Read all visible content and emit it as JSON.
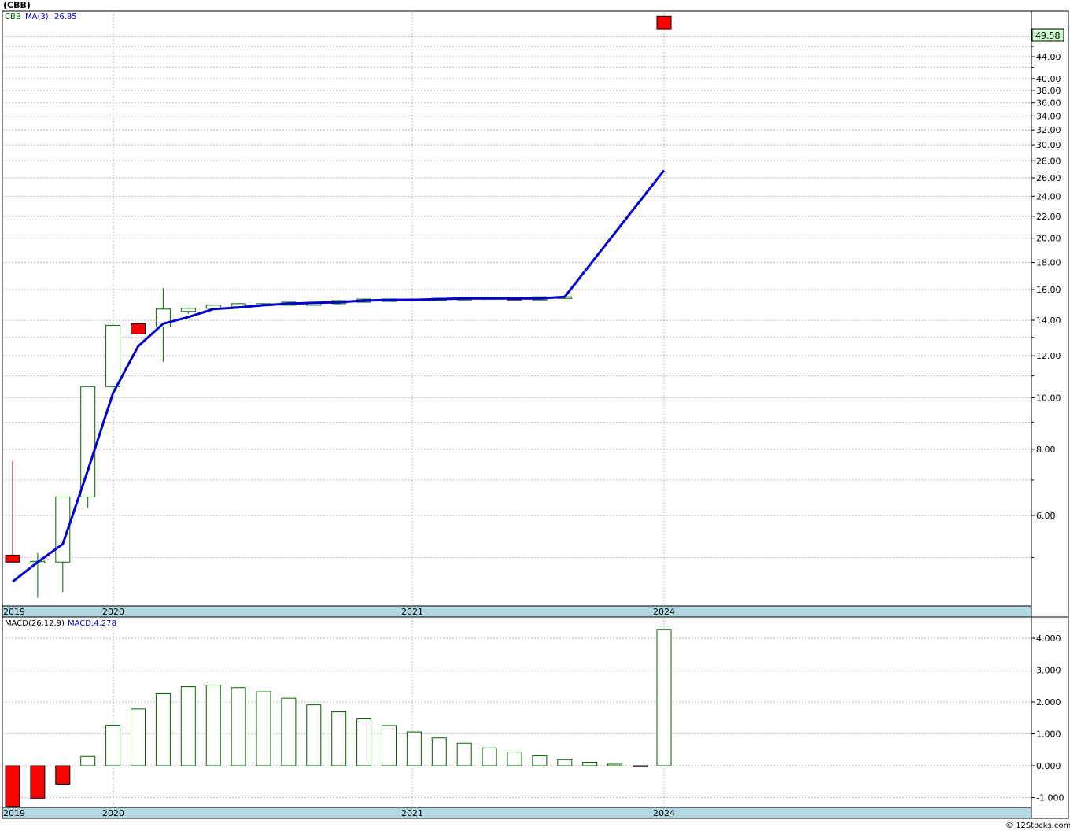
{
  "title": "(CBB)",
  "credit": "© 12Stocks.com",
  "colors": {
    "up_candle_border": "#006400",
    "down_candle_fill": "#ff0000",
    "ma_line": "#0000cc",
    "grid": "#aaaaaa",
    "axis_band": "#b0d8e0",
    "last_price_box": "#ccffcc",
    "macd_up_border": "#006400",
    "macd_down_fill": "#ff0000"
  },
  "price_panel": {
    "legend": {
      "symbol": "CBB",
      "ma_label": "MA(3)",
      "ma_value": "26.85"
    },
    "last_price": "49.58",
    "y_ticks": [
      "44.00",
      "40.00",
      "38.00",
      "36.00",
      "34.00",
      "32.00",
      "30.00",
      "28.00",
      "26.00",
      "24.00",
      "22.00",
      "20.00",
      "18.00",
      "16.00",
      "14.00",
      "12.00",
      "10.00",
      "8.00",
      "6.00"
    ],
    "x_labels": [
      "2019",
      "2020",
      "2021",
      "2024"
    ]
  },
  "macd_panel": {
    "legend": {
      "label": "MACD(26,12,9)",
      "value_label": "MACD:4.278"
    },
    "y_ticks": [
      "4.000",
      "3.000",
      "2.000",
      "1.000",
      "0.000",
      "-1.000"
    ],
    "x_labels": [
      "2019",
      "2020",
      "2021",
      "2024"
    ]
  },
  "chart_data": [
    {
      "type": "candlestick",
      "title": "(CBB)",
      "scale": "log",
      "ylim": [
        4.6,
        55
      ],
      "series": [
        {
          "name": "CBB",
          "ohlc": [
            [
              5.05,
              7.6,
              4.9,
              4.9
            ],
            [
              4.9,
              5.1,
              4.2,
              4.9
            ],
            [
              4.9,
              6.5,
              4.3,
              6.5
            ],
            [
              6.5,
              10.5,
              6.2,
              10.5
            ],
            [
              10.5,
              13.8,
              10.3,
              13.7
            ],
            [
              13.8,
              13.9,
              12.1,
              13.2
            ],
            [
              13.6,
              16.1,
              11.7,
              14.7
            ],
            [
              14.6,
              14.8,
              14.4,
              14.7
            ],
            [
              14.8,
              14.9,
              14.7,
              14.9
            ],
            [
              14.9,
              15.0,
              14.8,
              15.0
            ],
            [
              15.0,
              15.1,
              14.9,
              15.0
            ],
            [
              15.0,
              15.1,
              14.95,
              15.1
            ],
            [
              15.0,
              15.1,
              15.0,
              15.1
            ],
            [
              15.1,
              15.3,
              15.0,
              15.2
            ],
            [
              15.2,
              15.3,
              15.15,
              15.3
            ],
            [
              15.25,
              15.35,
              15.2,
              15.3
            ],
            [
              15.3,
              15.35,
              15.25,
              15.3
            ],
            [
              15.3,
              15.4,
              15.25,
              15.35
            ],
            [
              15.35,
              15.45,
              15.3,
              15.4
            ],
            [
              15.4,
              15.45,
              15.35,
              15.4
            ],
            [
              15.4,
              15.45,
              15.3,
              15.35
            ],
            [
              15.35,
              15.45,
              15.3,
              15.45
            ],
            [
              15.45,
              15.5,
              15.4,
              15.45
            ],
            [
              52.5,
              52.5,
              49.58,
              49.58
            ]
          ]
        },
        {
          "name": "MA(3)",
          "values": [
            4.5,
            4.9,
            5.3,
            7.3,
            10.2,
            12.5,
            13.8,
            14.2,
            14.7,
            14.8,
            14.95,
            15.05,
            15.1,
            15.15,
            15.25,
            15.3,
            15.3,
            15.35,
            15.4,
            15.4,
            15.4,
            15.4,
            15.5,
            26.85
          ]
        }
      ]
    },
    {
      "type": "bar",
      "title": "MACD(26,12,9)",
      "ylim": [
        -1.3,
        4.4
      ],
      "series": [
        {
          "name": "MACD",
          "values": [
            -1.28,
            -1.02,
            -0.58,
            0.29,
            1.27,
            1.78,
            2.26,
            2.48,
            2.53,
            2.45,
            2.32,
            2.12,
            1.91,
            1.69,
            1.47,
            1.26,
            1.06,
            0.87,
            0.71,
            0.56,
            0.43,
            0.31,
            0.19,
            0.11,
            0.05,
            -0.03,
            4.278
          ]
        }
      ]
    }
  ]
}
